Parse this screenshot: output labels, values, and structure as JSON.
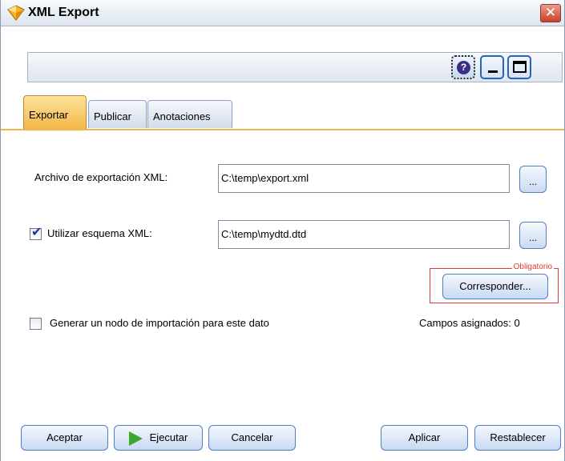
{
  "window": {
    "title": "XML Export"
  },
  "toolbar": {
    "help_icon_label": "?"
  },
  "tabs": [
    {
      "label": "Exportar",
      "active": true
    },
    {
      "label": "Publicar",
      "active": false
    },
    {
      "label": "Anotaciones",
      "active": false
    }
  ],
  "form": {
    "export_file_label": "Archivo de exportación XML:",
    "export_file_value": "C:\\temp\\export.xml",
    "schema_checkbox_label": "Utilizar esquema XML:",
    "schema_checked": true,
    "schema_value": "C:\\temp\\mydtd.dtd",
    "browse_label": "...",
    "mandatory_label": "Obligatorio",
    "map_button_label": "Corresponder...",
    "import_node_label": "Generar un nodo de importación para este dato",
    "import_node_checked": false,
    "assigned_fields_label": "Campos asignados: 0"
  },
  "footer": {
    "ok_label": "Aceptar",
    "run_label": "Ejecutar",
    "cancel_label": "Cancelar",
    "apply_label": "Aplicar",
    "reset_label": "Restablecer"
  }
}
